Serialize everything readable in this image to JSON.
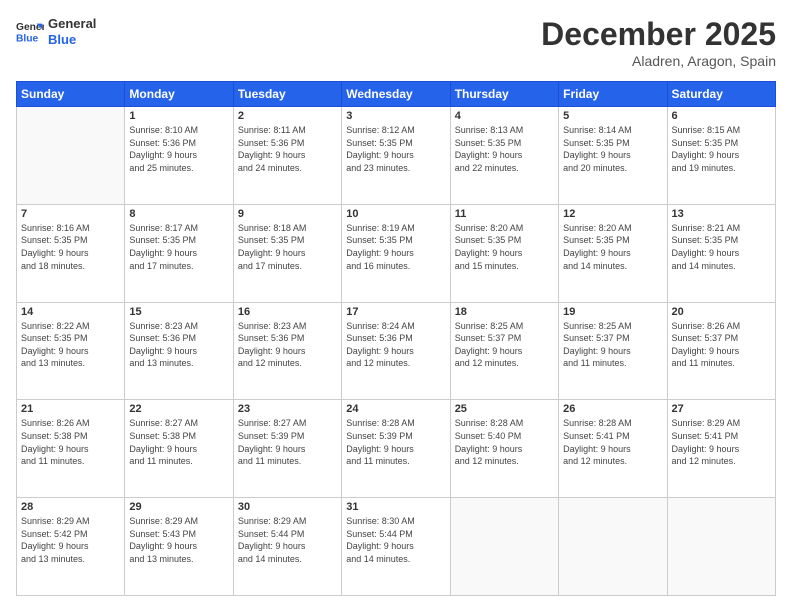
{
  "logo": {
    "line1": "General",
    "line2": "Blue"
  },
  "title": "December 2025",
  "location": "Aladren, Aragon, Spain",
  "days_of_week": [
    "Sunday",
    "Monday",
    "Tuesday",
    "Wednesday",
    "Thursday",
    "Friday",
    "Saturday"
  ],
  "weeks": [
    [
      {
        "day": "",
        "info": ""
      },
      {
        "day": "1",
        "info": "Sunrise: 8:10 AM\nSunset: 5:36 PM\nDaylight: 9 hours\nand 25 minutes."
      },
      {
        "day": "2",
        "info": "Sunrise: 8:11 AM\nSunset: 5:36 PM\nDaylight: 9 hours\nand 24 minutes."
      },
      {
        "day": "3",
        "info": "Sunrise: 8:12 AM\nSunset: 5:35 PM\nDaylight: 9 hours\nand 23 minutes."
      },
      {
        "day": "4",
        "info": "Sunrise: 8:13 AM\nSunset: 5:35 PM\nDaylight: 9 hours\nand 22 minutes."
      },
      {
        "day": "5",
        "info": "Sunrise: 8:14 AM\nSunset: 5:35 PM\nDaylight: 9 hours\nand 20 minutes."
      },
      {
        "day": "6",
        "info": "Sunrise: 8:15 AM\nSunset: 5:35 PM\nDaylight: 9 hours\nand 19 minutes."
      }
    ],
    [
      {
        "day": "7",
        "info": "Sunrise: 8:16 AM\nSunset: 5:35 PM\nDaylight: 9 hours\nand 18 minutes."
      },
      {
        "day": "8",
        "info": "Sunrise: 8:17 AM\nSunset: 5:35 PM\nDaylight: 9 hours\nand 17 minutes."
      },
      {
        "day": "9",
        "info": "Sunrise: 8:18 AM\nSunset: 5:35 PM\nDaylight: 9 hours\nand 17 minutes."
      },
      {
        "day": "10",
        "info": "Sunrise: 8:19 AM\nSunset: 5:35 PM\nDaylight: 9 hours\nand 16 minutes."
      },
      {
        "day": "11",
        "info": "Sunrise: 8:20 AM\nSunset: 5:35 PM\nDaylight: 9 hours\nand 15 minutes."
      },
      {
        "day": "12",
        "info": "Sunrise: 8:20 AM\nSunset: 5:35 PM\nDaylight: 9 hours\nand 14 minutes."
      },
      {
        "day": "13",
        "info": "Sunrise: 8:21 AM\nSunset: 5:35 PM\nDaylight: 9 hours\nand 14 minutes."
      }
    ],
    [
      {
        "day": "14",
        "info": "Sunrise: 8:22 AM\nSunset: 5:35 PM\nDaylight: 9 hours\nand 13 minutes."
      },
      {
        "day": "15",
        "info": "Sunrise: 8:23 AM\nSunset: 5:36 PM\nDaylight: 9 hours\nand 13 minutes."
      },
      {
        "day": "16",
        "info": "Sunrise: 8:23 AM\nSunset: 5:36 PM\nDaylight: 9 hours\nand 12 minutes."
      },
      {
        "day": "17",
        "info": "Sunrise: 8:24 AM\nSunset: 5:36 PM\nDaylight: 9 hours\nand 12 minutes."
      },
      {
        "day": "18",
        "info": "Sunrise: 8:25 AM\nSunset: 5:37 PM\nDaylight: 9 hours\nand 12 minutes."
      },
      {
        "day": "19",
        "info": "Sunrise: 8:25 AM\nSunset: 5:37 PM\nDaylight: 9 hours\nand 11 minutes."
      },
      {
        "day": "20",
        "info": "Sunrise: 8:26 AM\nSunset: 5:37 PM\nDaylight: 9 hours\nand 11 minutes."
      }
    ],
    [
      {
        "day": "21",
        "info": "Sunrise: 8:26 AM\nSunset: 5:38 PM\nDaylight: 9 hours\nand 11 minutes."
      },
      {
        "day": "22",
        "info": "Sunrise: 8:27 AM\nSunset: 5:38 PM\nDaylight: 9 hours\nand 11 minutes."
      },
      {
        "day": "23",
        "info": "Sunrise: 8:27 AM\nSunset: 5:39 PM\nDaylight: 9 hours\nand 11 minutes."
      },
      {
        "day": "24",
        "info": "Sunrise: 8:28 AM\nSunset: 5:39 PM\nDaylight: 9 hours\nand 11 minutes."
      },
      {
        "day": "25",
        "info": "Sunrise: 8:28 AM\nSunset: 5:40 PM\nDaylight: 9 hours\nand 12 minutes."
      },
      {
        "day": "26",
        "info": "Sunrise: 8:28 AM\nSunset: 5:41 PM\nDaylight: 9 hours\nand 12 minutes."
      },
      {
        "day": "27",
        "info": "Sunrise: 8:29 AM\nSunset: 5:41 PM\nDaylight: 9 hours\nand 12 minutes."
      }
    ],
    [
      {
        "day": "28",
        "info": "Sunrise: 8:29 AM\nSunset: 5:42 PM\nDaylight: 9 hours\nand 13 minutes."
      },
      {
        "day": "29",
        "info": "Sunrise: 8:29 AM\nSunset: 5:43 PM\nDaylight: 9 hours\nand 13 minutes."
      },
      {
        "day": "30",
        "info": "Sunrise: 8:29 AM\nSunset: 5:44 PM\nDaylight: 9 hours\nand 14 minutes."
      },
      {
        "day": "31",
        "info": "Sunrise: 8:30 AM\nSunset: 5:44 PM\nDaylight: 9 hours\nand 14 minutes."
      },
      {
        "day": "",
        "info": ""
      },
      {
        "day": "",
        "info": ""
      },
      {
        "day": "",
        "info": ""
      }
    ]
  ]
}
